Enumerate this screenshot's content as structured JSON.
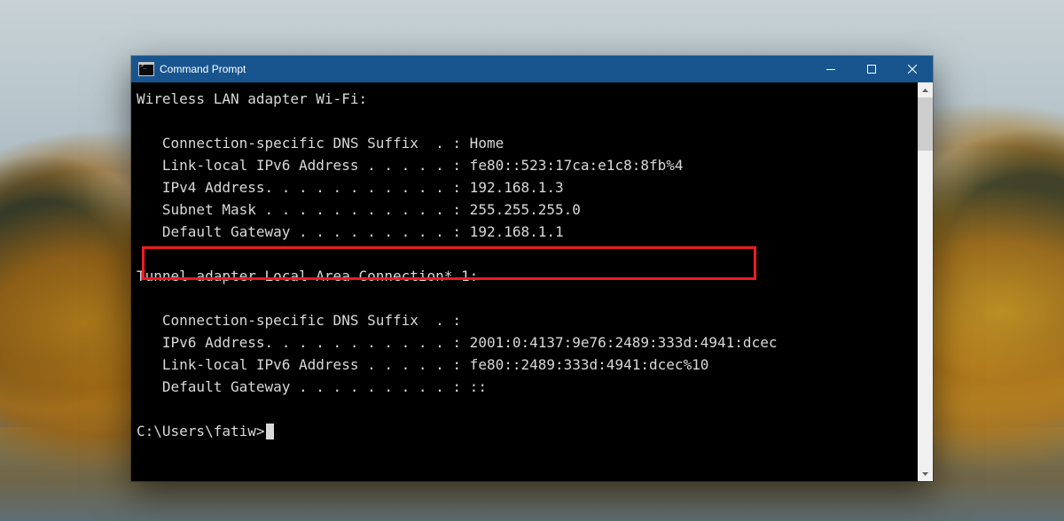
{
  "window": {
    "title": "Command Prompt"
  },
  "terminal": {
    "section1_header": "Wireless LAN adapter Wi-Fi:",
    "s1_dns": "   Connection-specific DNS Suffix  . : Home",
    "s1_ipv6": "   Link-local IPv6 Address . . . . . : fe80::523:17ca:e1c8:8fb%4",
    "s1_ipv4": "   IPv4 Address. . . . . . . . . . . : 192.168.1.3",
    "s1_mask": "   Subnet Mask . . . . . . . . . . . : 255.255.255.0",
    "s1_gw": "   Default Gateway . . . . . . . . . : 192.168.1.1",
    "section2_header": "Tunnel adapter Local Area Connection* 1:",
    "s2_dns": "   Connection-specific DNS Suffix  . :",
    "s2_ipv6": "   IPv6 Address. . . . . . . . . . . : 2001:0:4137:9e76:2489:333d:4941:dcec",
    "s2_ll6": "   Link-local IPv6 Address . . . . . : fe80::2489:333d:4941:dcec%10",
    "s2_gw": "   Default Gateway . . . . . . . . . : ::",
    "prompt": "C:\\Users\\fatiw>"
  },
  "highlight": {
    "description": "Red rectangle highlighting the Default Gateway line 192.168.1.1"
  }
}
